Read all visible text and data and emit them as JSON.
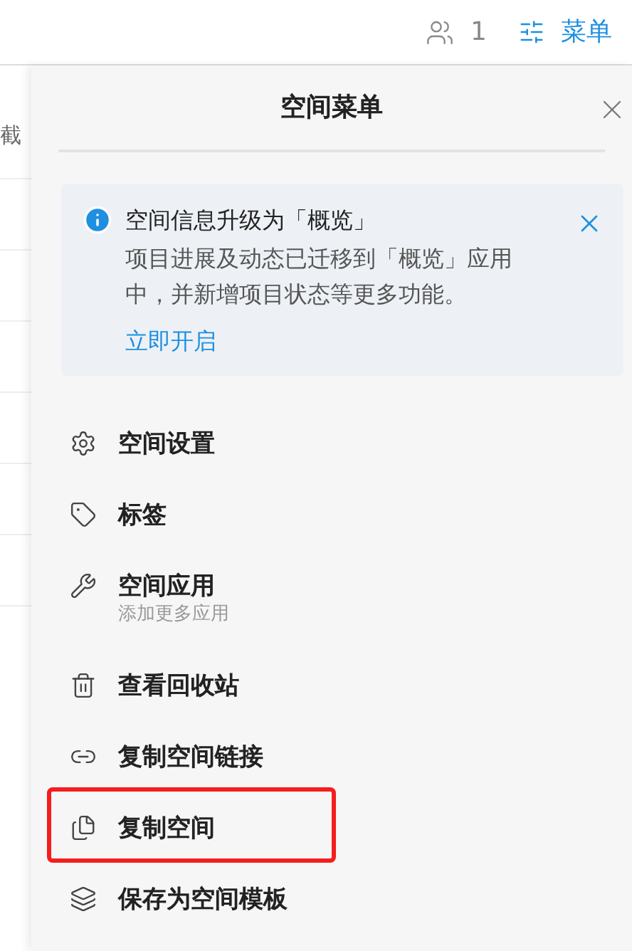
{
  "top_bar": {
    "members_count": "1",
    "menu_button": "菜单"
  },
  "background_table": {
    "cells": [
      "截"
    ]
  },
  "panel": {
    "title": "空间菜单",
    "notice": {
      "title": "空间信息升级为「概览」",
      "body": "项目进展及动态已迁移到「概览」应用中，并新增项目状态等更多功能。",
      "link": "立即开启"
    },
    "items": [
      {
        "kind": "gear",
        "label": "空间设置",
        "highlighted": false
      },
      {
        "kind": "tag",
        "label": "标签",
        "highlighted": false
      },
      {
        "kind": "wrench",
        "label": "空间应用",
        "subtitle": "添加更多应用",
        "highlighted": false
      },
      {
        "kind": "trash",
        "label": "查看回收站",
        "highlighted": false
      },
      {
        "kind": "link",
        "label": "复制空间链接",
        "highlighted": false
      },
      {
        "kind": "copy",
        "label": "复制空间",
        "highlighted": true
      },
      {
        "kind": "layers",
        "label": "保存为空间模板",
        "highlighted": false
      }
    ]
  }
}
